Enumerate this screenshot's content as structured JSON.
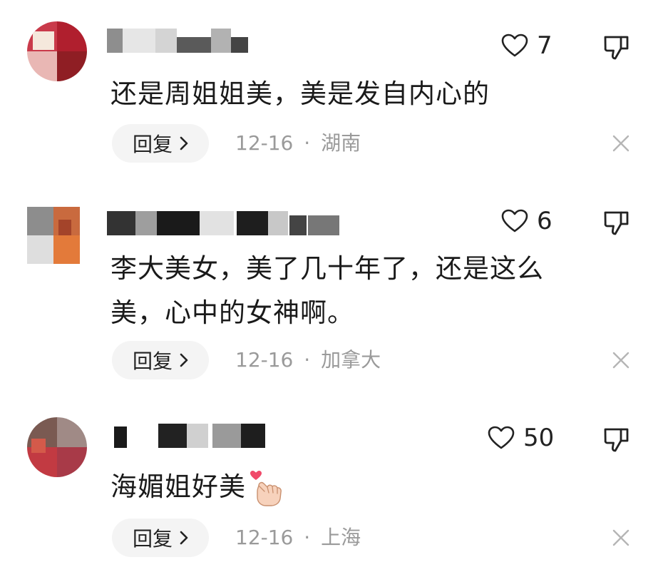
{
  "comments": [
    {
      "username": "",
      "likes": "7",
      "text": "还是周姐姐美，美是发自内心的",
      "reply_label": "回复",
      "date": "12-16",
      "separator": "·",
      "location": "湖南"
    },
    {
      "username": "",
      "likes": "6",
      "text_line1": "李大美女，美了几十年了，还是这么",
      "text_line2": "美，心中的女神啊。",
      "reply_label": "回复",
      "date": "12-16",
      "separator": "·",
      "location": "加拿大"
    },
    {
      "username": "",
      "likes": "50",
      "text": "海媚姐好美",
      "emoji": "finger-heart",
      "reply_label": "回复",
      "date": "12-16",
      "separator": "·",
      "location": "上海"
    }
  ],
  "colors": {
    "text": "#1a1a1a",
    "meta": "#9a9a9a",
    "reply_bg": "#f4f4f4",
    "icon": "#222222"
  }
}
